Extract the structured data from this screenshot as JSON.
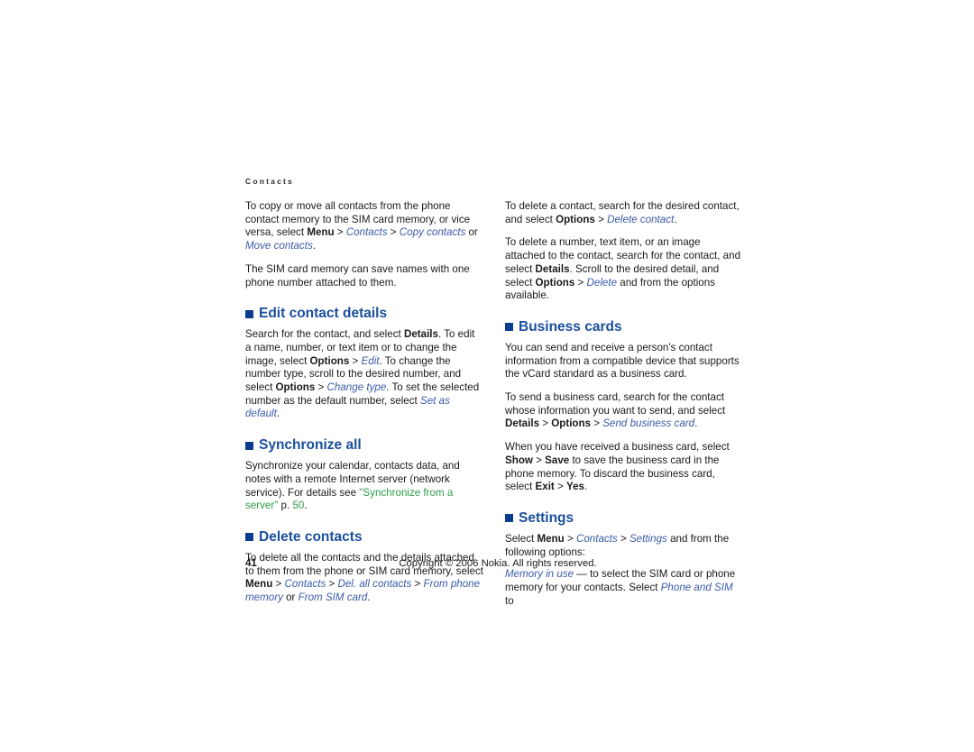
{
  "document": {
    "running_header": "Contacts",
    "page_number": "41",
    "copyright": "Copyright © 2006 Nokia. All rights reserved."
  },
  "colors": {
    "heading_blue": "#1a4f9c",
    "bullet_blue": "#0a3d8f",
    "italic_link_blue": "#3a5ba8",
    "cross_reference_green": "#2e9b4a",
    "body_text": "#1a1a1a",
    "page_background": "#ffffff"
  },
  "left_column": {
    "intro_para_1": {
      "t1": "To copy or move all contacts from the phone contact memory to the SIM card memory, or vice versa, select ",
      "menu": "Menu",
      "sep1": " > ",
      "contacts": "Contacts",
      "sep2": " > ",
      "copy_contacts": "Copy contacts",
      "or": " or ",
      "move_contacts": "Move contacts",
      "end": "."
    },
    "intro_para_2": "The SIM card memory can save names with one phone number attached to them.",
    "sections": [
      {
        "heading": "Edit contact details",
        "para": {
          "t1": "Search for the contact, and select ",
          "details": "Details",
          "t2": ". To edit a name, number, or text item or to change the image, select ",
          "options1": "Options",
          "sep1": " > ",
          "edit": "Edit",
          "t3": ". To change the number type, scroll to the desired number, and select ",
          "options2": "Options",
          "sep2": " > ",
          "change_type": "Change type",
          "t4": ". To set the selected number as the default number, select ",
          "set_as_default": "Set as default",
          "end": "."
        }
      },
      {
        "heading": "Synchronize all",
        "para": {
          "t1": "Synchronize your calendar, contacts data, and notes with a remote Internet server (network service). For details see ",
          "xref": "\"Synchronize from a server\"",
          "t2": " p. ",
          "xref_page": "50",
          "end": "."
        }
      },
      {
        "heading": "Delete contacts",
        "para": {
          "t1": "To delete all the contacts and the details attached to them from the phone or SIM card memory, select ",
          "menu": "Menu",
          "sep1": " > ",
          "contacts": "Contacts",
          "sep2": " > ",
          "del_all": "Del. all contacts",
          "sep3": " > ",
          "from_phone_memory": "From phone memory",
          "or": " or ",
          "from_sim_card": "From SIM card",
          "end": "."
        }
      }
    ]
  },
  "right_column": {
    "intro_para_1": {
      "t1": "To delete a contact, search for the desired contact, and select ",
      "options": "Options",
      "sep1": " > ",
      "delete_contact": "Delete contact",
      "end": "."
    },
    "intro_para_2": {
      "t1": "To delete a number, text item, or an image attached to the contact, search for the contact, and select ",
      "details": "Details",
      "t2": ". Scroll to the desired detail, and select ",
      "options": "Options",
      "sep1": " > ",
      "delete": "Delete",
      "t3": " and from the options available."
    },
    "sections": [
      {
        "heading": "Business cards",
        "para_1": "You can send and receive a person's contact information from a compatible device that supports the vCard standard as a business card.",
        "para_2": {
          "t1": "To send a business card, search for the contact whose information you want to send, and select ",
          "details": "Details",
          "sep1": " > ",
          "options": "Options",
          "sep2": " > ",
          "send_business_card": "Send business card",
          "end": "."
        },
        "para_3": {
          "t1": "When you have received a business card, select ",
          "show": "Show",
          "sep1": " > ",
          "save": "Save",
          "t2": " to save the business card in the phone memory. To discard the business card, select ",
          "exit": "Exit",
          "sep2": " > ",
          "yes": "Yes",
          "end": "."
        }
      },
      {
        "heading": "Settings",
        "para_1": {
          "t1": "Select ",
          "menu": "Menu",
          "sep1": " > ",
          "contacts": "Contacts",
          "sep2": " > ",
          "settings": "Settings",
          "t2": " and from the following options:"
        },
        "para_2": {
          "memory_in_use": "Memory in use",
          "t1": " — to select the SIM card or phone memory for your contacts. Select ",
          "phone_and_sim": "Phone and SIM",
          "t2": " to"
        }
      }
    ]
  }
}
